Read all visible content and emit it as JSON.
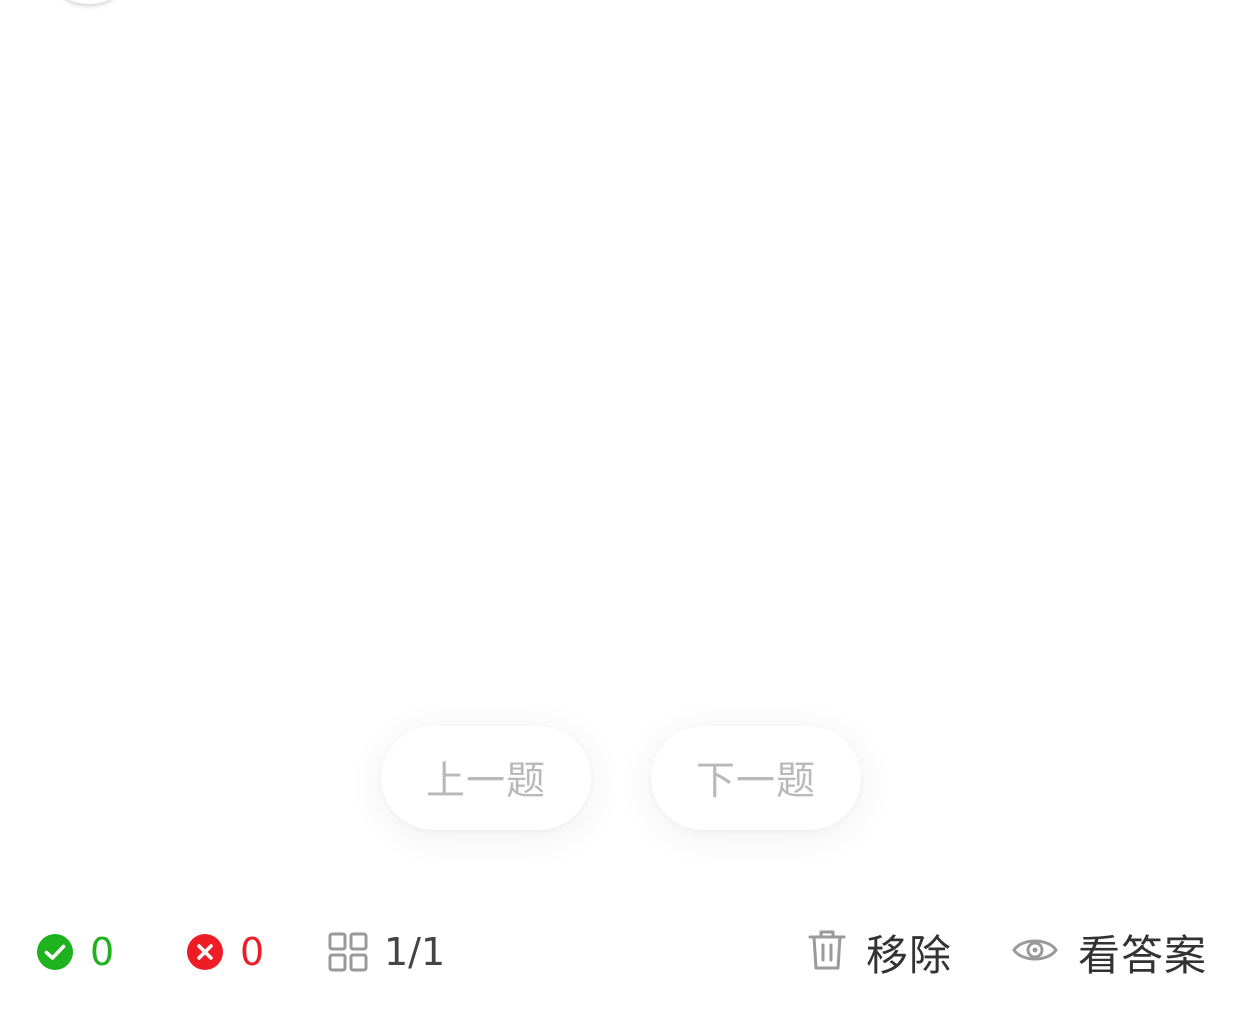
{
  "nav": {
    "prev_label": "上一题",
    "next_label": "下一题"
  },
  "stats": {
    "correct_count": "0",
    "wrong_count": "0",
    "progress": "1/1"
  },
  "actions": {
    "remove_label": "移除",
    "answer_label": "看答案"
  },
  "icons": {
    "correct": "check-circle-icon",
    "wrong": "x-circle-icon",
    "progress": "grid-icon",
    "remove": "trash-icon",
    "answer": "eye-icon"
  },
  "colors": {
    "correct": "#1fb21f",
    "wrong": "#ee1c25",
    "muted_text": "#b9b9b9",
    "icon_gray": "#9a9a9a",
    "text": "#333333"
  }
}
